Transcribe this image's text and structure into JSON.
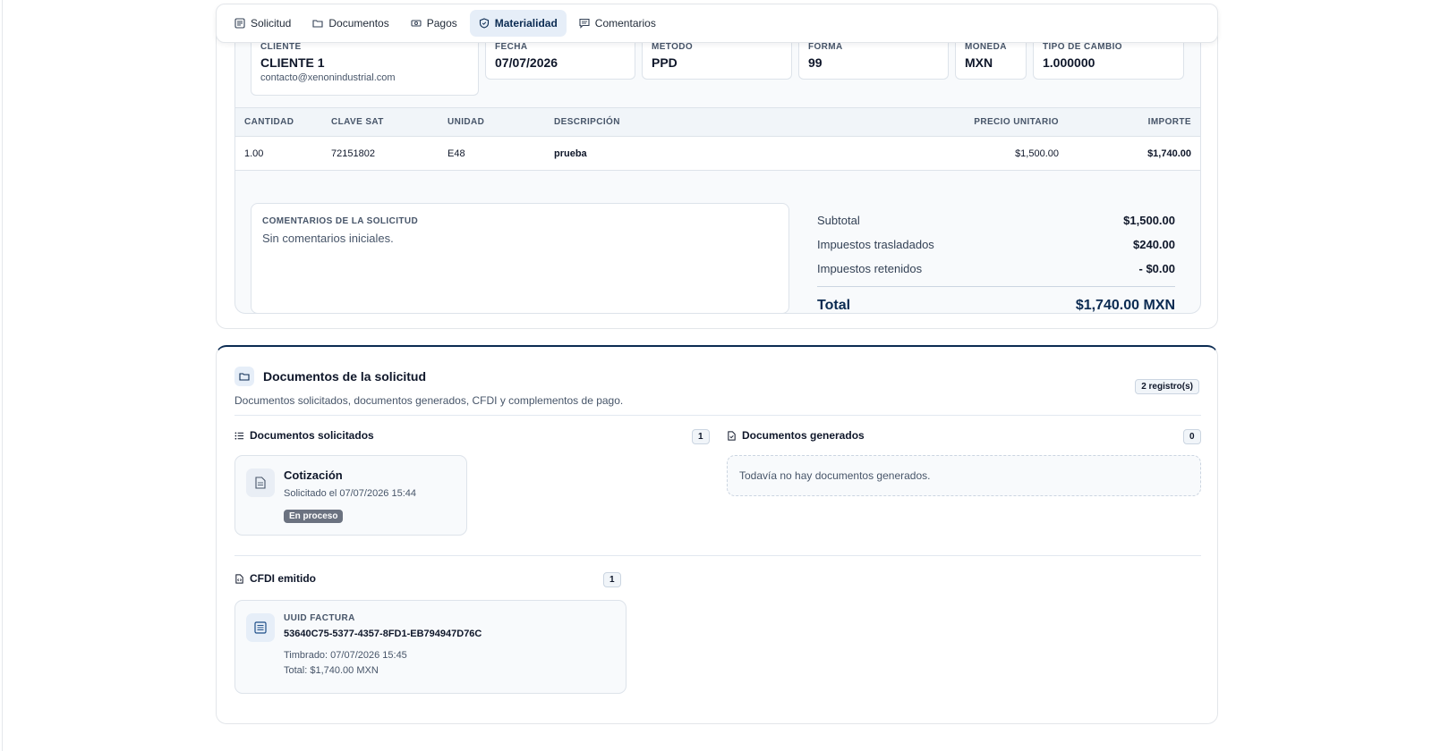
{
  "tabs": [
    {
      "label": "Solicitud",
      "icon": "list-icon"
    },
    {
      "label": "Documentos",
      "icon": "folder-icon"
    },
    {
      "label": "Pagos",
      "icon": "cash-icon"
    },
    {
      "label": "Materialidad",
      "icon": "shield-icon",
      "active": true
    },
    {
      "label": "Comentarios",
      "icon": "message-icon"
    }
  ],
  "details": {
    "cliente": {
      "label": "CLIENTE",
      "value": "CLIENTE 1",
      "email": "contacto@xenonindustrial.com"
    },
    "fecha": {
      "label": "FECHA",
      "value": "07/07/2026"
    },
    "metodo": {
      "label": "METODO",
      "value": "PPD"
    },
    "forma": {
      "label": "FORMA",
      "value": "99"
    },
    "moneda": {
      "label": "MONEDA",
      "value": "MXN"
    },
    "tipo_cambio": {
      "label": "TIPO DE CAMBIO",
      "value": "1.000000"
    }
  },
  "items_table": {
    "headers": [
      "CANTIDAD",
      "CLAVE SAT",
      "UNIDAD",
      "DESCRIPCIÓN",
      "PRECIO UNITARIO",
      "IMPORTE"
    ],
    "rows": [
      [
        "1.00",
        "72151802",
        "E48",
        "prueba",
        "$1,500.00",
        "$1,740.00"
      ]
    ]
  },
  "comments": {
    "label": "COMENTARIOS DE LA SOLICITUD",
    "text": "Sin comentarios iniciales."
  },
  "totals": {
    "subtotal_label": "Subtotal",
    "subtotal": "$1,500.00",
    "trasladados_label": "Impuestos trasladados",
    "trasladados": "$240.00",
    "retenidos_label": "Impuestos retenidos",
    "retenidos": "- $0.00",
    "total_label": "Total",
    "total": "$1,740.00 MXN"
  },
  "documents": {
    "title": "Documentos de la solicitud",
    "subtitle": "Documentos solicitados, documentos generados, CFDI y complementos de pago.",
    "records_badge": "2 registro(s)",
    "requested": {
      "title": "Documentos solicitados",
      "count": "1",
      "items": [
        {
          "title": "Cotización",
          "meta": "Solicitado el 07/07/2026 15:44",
          "status": "En proceso"
        }
      ]
    },
    "generated": {
      "title": "Documentos generados",
      "count": "0",
      "empty_text": "Todavía no hay documentos generados."
    },
    "cfdi": {
      "title": "CFDI emitido",
      "count": "1",
      "uuid_label": "UUID FACTURA",
      "uuid": "53640C75-5377-4357-8FD1-EB794947D76C",
      "timbrado": "Timbrado: 07/07/2026 15:45",
      "total": "Total: $1,740.00 MXN"
    }
  },
  "colors": {
    "primary": "#0b2b52",
    "tab_active_bg": "#e6eef8",
    "status_pill": "#6b7280"
  }
}
